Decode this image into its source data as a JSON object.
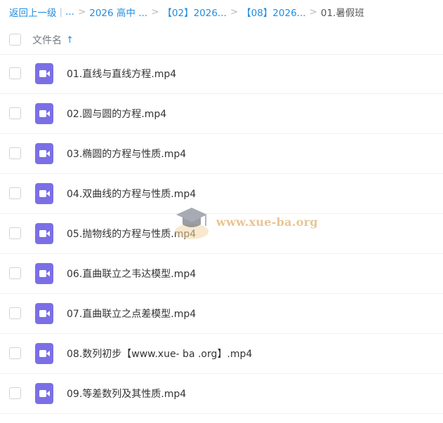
{
  "breadcrumb": {
    "back_label": "返回上一级",
    "ellipsis": "...",
    "items": [
      "2026 高中 ...",
      "【02】2026...",
      "【08】2026..."
    ],
    "current": "01.暑假班"
  },
  "list_header": {
    "column_label": "文件名",
    "sort_icon": "arrow-up-icon",
    "sort_glyph": "↑"
  },
  "files": [
    {
      "name": "01.直线与直线方程.mp4",
      "icon": "video-file-icon"
    },
    {
      "name": "02.圆与圆的方程.mp4",
      "icon": "video-file-icon"
    },
    {
      "name": "03.椭圆的方程与性质.mp4",
      "icon": "video-file-icon"
    },
    {
      "name": "04.双曲线的方程与性质.mp4",
      "icon": "video-file-icon"
    },
    {
      "name": "05.抛物线的方程与性质.mp4",
      "icon": "video-file-icon"
    },
    {
      "name": "06.直曲联立之韦达模型.mp4",
      "icon": "video-file-icon"
    },
    {
      "name": "07.直曲联立之点差模型.mp4",
      "icon": "video-file-icon"
    },
    {
      "name": "08.数列初步【www.xue- ba .org】.mp4",
      "icon": "video-file-icon"
    },
    {
      "name": "09.等差数列及其性质.mp4",
      "icon": "video-file-icon"
    }
  ],
  "watermark": {
    "text": "www.xue-ba.org"
  },
  "colors": {
    "link": "#1f8de0",
    "file_icon": "#7b6fe6",
    "watermark": "#e3b77a"
  }
}
